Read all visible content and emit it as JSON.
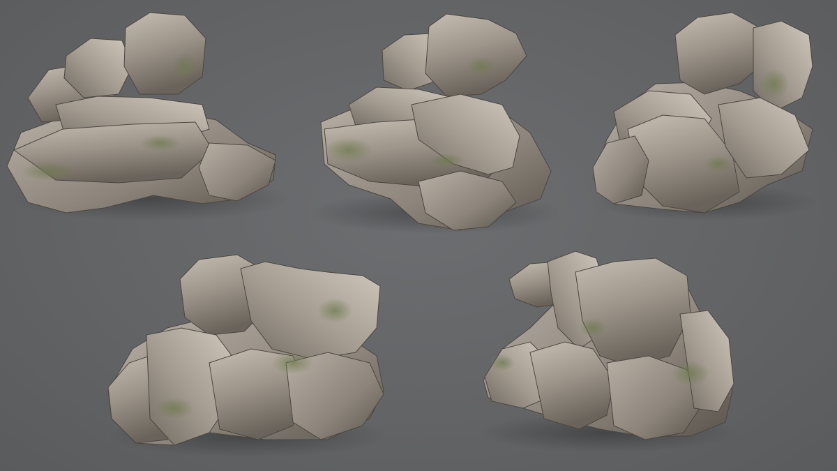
{
  "scene": {
    "background_color": "#656668",
    "rock_base_color": "#9c948a",
    "rock_highlight_color": "#c9c1b6",
    "rock_shadow_color": "#4b4641",
    "moss_color": "#6f7a4f",
    "rock_clusters": [
      {
        "id": "rock-cluster-1"
      },
      {
        "id": "rock-cluster-2"
      },
      {
        "id": "rock-cluster-3"
      },
      {
        "id": "rock-cluster-4"
      },
      {
        "id": "rock-cluster-5"
      }
    ]
  }
}
